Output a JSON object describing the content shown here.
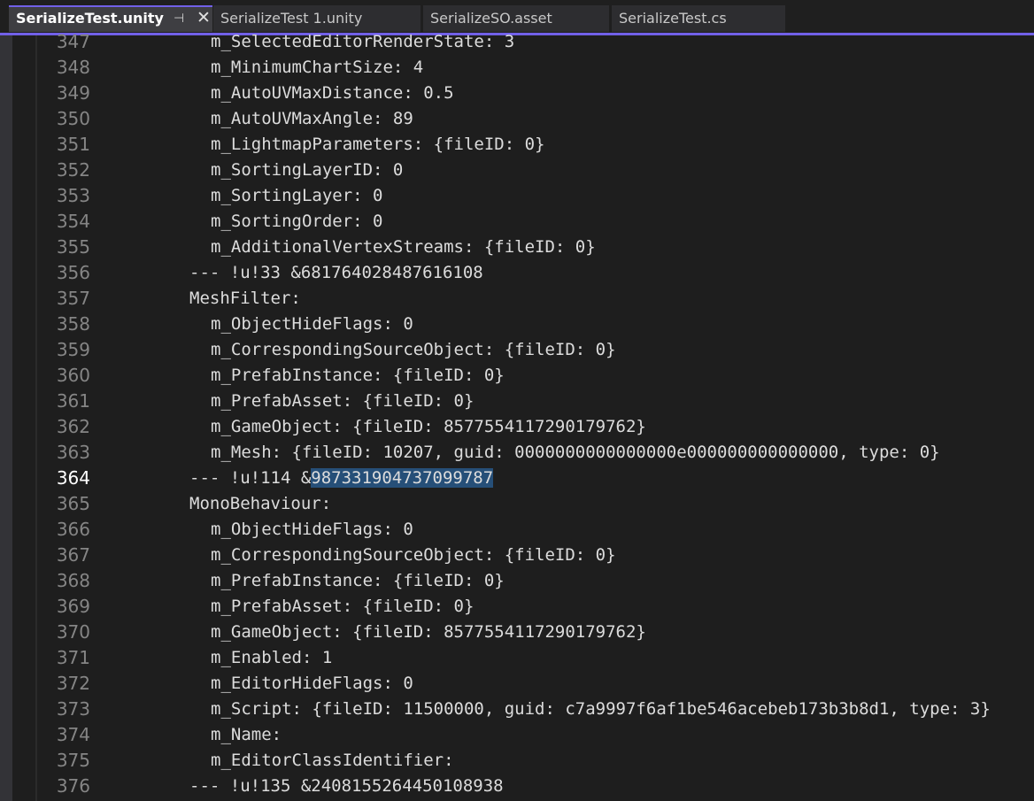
{
  "tabs": [
    {
      "label": "SerializeTest.unity",
      "active": true
    },
    {
      "label": "SerializeTest 1.unity",
      "active": false
    },
    {
      "label": "SerializeSO.asset",
      "active": false
    },
    {
      "label": "SerializeTest.cs",
      "active": false
    }
  ],
  "tab_icons": {
    "pin": "pin-icon",
    "close": "close-icon"
  },
  "colors": {
    "accent": "#7160e8",
    "editor_bg": "#1e1e1e",
    "selection": "#264f78",
    "line_number": "#858585",
    "code_text": "#dcdcdc"
  },
  "editor": {
    "current_line": "364",
    "selected_text": "987331904737099787",
    "lines": [
      {
        "num": "347",
        "text": "m_SelectedEditorRenderState: 3"
      },
      {
        "num": "348",
        "text": "m_MinimumChartSize: 4"
      },
      {
        "num": "349",
        "text": "m_AutoUVMaxDistance: 0.5"
      },
      {
        "num": "350",
        "text": "m_AutoUVMaxAngle: 89"
      },
      {
        "num": "351",
        "text": "m_LightmapParameters: {fileID: 0}"
      },
      {
        "num": "352",
        "text": "m_SortingLayerID: 0"
      },
      {
        "num": "353",
        "text": "m_SortingLayer: 0"
      },
      {
        "num": "354",
        "text": "m_SortingOrder: 0"
      },
      {
        "num": "355",
        "text": "m_AdditionalVertexStreams: {fileID: 0}"
      },
      {
        "num": "356",
        "text": "--- !u!33 &681764028487616108"
      },
      {
        "num": "357",
        "text": "MeshFilter:"
      },
      {
        "num": "358",
        "text": "m_ObjectHideFlags: 0"
      },
      {
        "num": "359",
        "text": "m_CorrespondingSourceObject: {fileID: 0}"
      },
      {
        "num": "360",
        "text": "m_PrefabInstance: {fileID: 0}"
      },
      {
        "num": "361",
        "text": "m_PrefabAsset: {fileID: 0}"
      },
      {
        "num": "362",
        "text": "m_GameObject: {fileID: 8577554117290179762}"
      },
      {
        "num": "363",
        "text": "m_Mesh: {fileID: 10207, guid: 0000000000000000e000000000000000, type: 0}"
      },
      {
        "num": "364",
        "text": "--- !u!114 &",
        "sel": "987331904737099787"
      },
      {
        "num": "365",
        "text": "MonoBehaviour:"
      },
      {
        "num": "366",
        "text": "m_ObjectHideFlags: 0"
      },
      {
        "num": "367",
        "text": "m_CorrespondingSourceObject: {fileID: 0}"
      },
      {
        "num": "368",
        "text": "m_PrefabInstance: {fileID: 0}"
      },
      {
        "num": "369",
        "text": "m_PrefabAsset: {fileID: 0}"
      },
      {
        "num": "370",
        "text": "m_GameObject: {fileID: 8577554117290179762}"
      },
      {
        "num": "371",
        "text": "m_Enabled: 1"
      },
      {
        "num": "372",
        "text": "m_EditorHideFlags: 0"
      },
      {
        "num": "373",
        "text": "m_Script: {fileID: 11500000, guid: c7a9997f6af1be546acebeb173b3b8d1, type: 3}"
      },
      {
        "num": "374",
        "text": "m_Name:"
      },
      {
        "num": "375",
        "text": "m_EditorClassIdentifier:"
      },
      {
        "num": "376",
        "text": "--- !u!135 &2408155264450108938"
      }
    ]
  }
}
